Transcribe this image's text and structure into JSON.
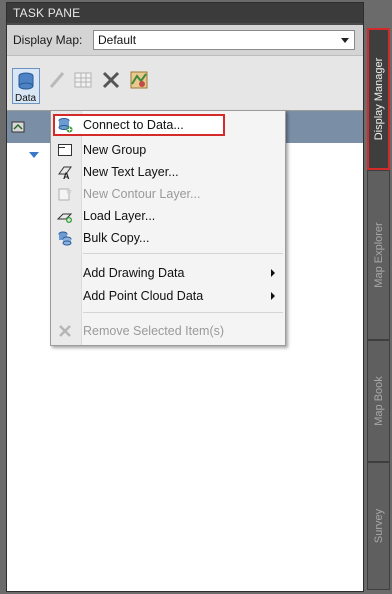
{
  "pane": {
    "title": "TASK PANE"
  },
  "display_map": {
    "label": "Display Map:",
    "value": "Default"
  },
  "toolbar": {
    "data_label": "Data"
  },
  "menu": {
    "items": [
      {
        "label": "Connect to Data...",
        "icon": "connect-data-icon",
        "state": "highlighted"
      },
      {
        "label": "New Group",
        "icon": "new-group-icon",
        "state": "enabled"
      },
      {
        "label": "New Text Layer...",
        "icon": "text-layer-icon",
        "state": "enabled"
      },
      {
        "label": "New Contour Layer...",
        "icon": "contour-layer-icon",
        "state": "disabled"
      },
      {
        "label": "Load Layer...",
        "icon": "load-layer-icon",
        "state": "enabled"
      },
      {
        "label": "Bulk Copy...",
        "icon": "bulk-copy-icon",
        "state": "enabled"
      },
      {
        "label": "Add Drawing Data",
        "icon": "",
        "state": "submenu"
      },
      {
        "label": "Add Point Cloud Data",
        "icon": "",
        "state": "submenu"
      },
      {
        "label": "Remove Selected Item(s)",
        "icon": "remove-icon",
        "state": "disabled"
      }
    ]
  },
  "side_tabs": [
    {
      "label": "Display Manager",
      "state": "active"
    },
    {
      "label": "Map Explorer",
      "state": "inactive"
    },
    {
      "label": "Map Book",
      "state": "inactive"
    },
    {
      "label": "Survey",
      "state": "inactive"
    }
  ],
  "colors": {
    "highlight_border": "#d42a2a",
    "active_tab_bg": "#3e3e3e"
  }
}
